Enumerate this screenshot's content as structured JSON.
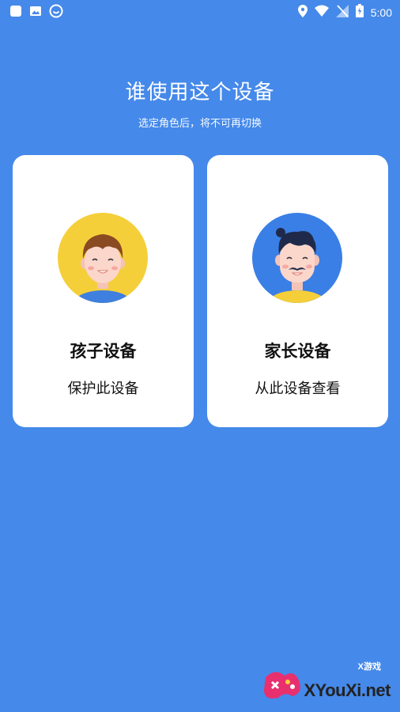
{
  "status_bar": {
    "time": "5:00",
    "left_icons": [
      "app-icon",
      "image-icon",
      "smiley-icon"
    ],
    "right_icons": [
      "location-icon",
      "wifi-icon",
      "no-signal-icon",
      "battery-icon"
    ]
  },
  "header": {
    "title": "谁使用这个设备",
    "subtitle": "选定角色后，将不可再切换"
  },
  "cards": [
    {
      "title": "孩子设备",
      "desc": "保护此设备",
      "avatar": "child-avatar"
    },
    {
      "title": "家长设备",
      "desc": "从此设备查看",
      "avatar": "parent-avatar"
    }
  ],
  "watermark": {
    "brand": "XYouXi.net",
    "badge": "X游戏"
  },
  "colors": {
    "background": "#4589ea",
    "card": "#ffffff",
    "child_circle": "#f5cf3a",
    "parent_circle": "#3a7fe6"
  }
}
